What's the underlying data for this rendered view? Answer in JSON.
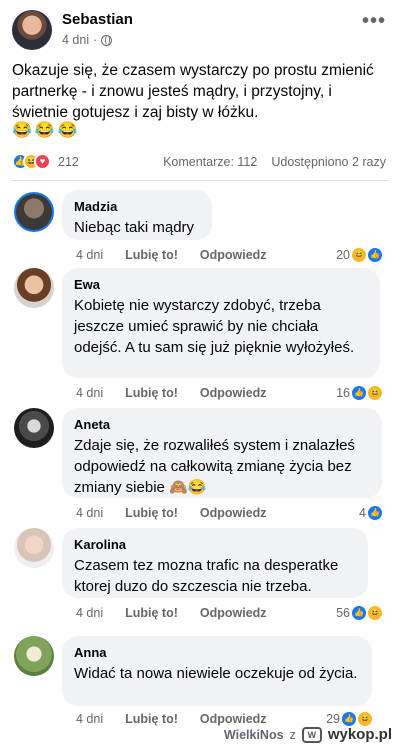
{
  "post": {
    "author": "Sebastian",
    "time": "4 dni",
    "dot": "·",
    "text": "Okazuje się, że czasem wystarczy po prostu zmienić partnerkę - i znowu jesteś mądry, i przystojny, i świetnie gotujesz i zaj  bisty w łóżku.",
    "emojis": "😂😂😂",
    "reaction_count": "212",
    "comments_label": "Komentarze: 112",
    "shares_label": "Udostępniono 2 razy",
    "icons": [
      "globe-icon",
      "more-icon",
      "like-reaction-icon",
      "haha-reaction-icon",
      "love-reaction-icon"
    ]
  },
  "actions": {
    "like_label": "Lubię to!",
    "reply_label": "Odpowiedz"
  },
  "comments": [
    {
      "name": "Madzia",
      "text": "Niebąc taki mądry",
      "time": "4 dni",
      "reactions": "20"
    },
    {
      "name": "Ewa",
      "text": "Kobietę nie wystarczy zdobyć, trzeba jeszcze umieć sprawić by nie chciała odejść. A tu sam się już pięknie wyłożyłeś.",
      "time": "4 dni",
      "reactions": "16"
    },
    {
      "name": "Aneta",
      "text": "Zdaje się, że rozwaliłeś system i znalazłeś odpowiedź na całkowitą zmianę życia bez zmiany siebie 🙈😂",
      "time": "4 dni",
      "reactions": "4"
    },
    {
      "name": "Karolina",
      "text": "Czasem tez mozna trafic na desperatke ktorej duzo do szczescia nie trzeba.",
      "time": "4 dni",
      "reactions": "56"
    },
    {
      "name": "Anna",
      "text": "Widać ta nowa niewiele oczekuje od życia.",
      "time": "4 dni",
      "reactions": "29"
    }
  ],
  "watermark": {
    "user": "WielkiNos",
    "z": "z",
    "site": "wykop.pl"
  },
  "colors": {
    "bubble": "#f0f2f5",
    "meta_text": "#65676b",
    "like_blue": "#1877f2",
    "haha_yellow": "#f7b928",
    "love_red": "#f33e58"
  }
}
